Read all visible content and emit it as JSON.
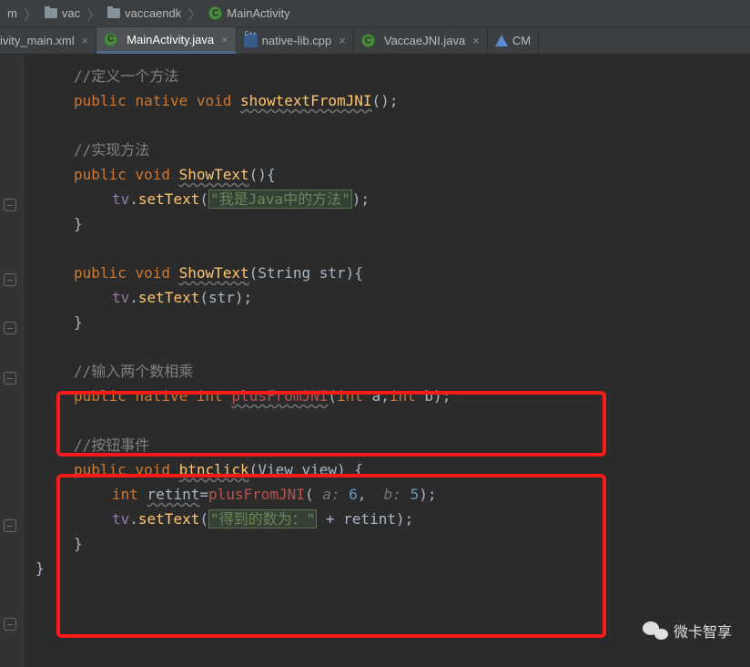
{
  "breadcrumb": {
    "item1": "m",
    "item2": "vac",
    "item3": "vaccaendk",
    "item4": "MainActivity"
  },
  "tabs": {
    "t1": "ivity_main.xml",
    "t2": "MainActivity.java",
    "t3": "native-lib.cpp",
    "t4": "VaccaeJNI.java",
    "t5": "CM"
  },
  "code": {
    "c1": "//定义一个方法",
    "kw_public": "public",
    "kw_native": "native",
    "kw_void": "void",
    "kw_int": "int",
    "m_showtext": "showtextFromJNI",
    "c2": "//实现方法",
    "m_ShowText": "ShowText",
    "f_tv": "tv",
    "m_setText": "setText",
    "s1": "\"我是Java中的方法\"",
    "p_String": "String",
    "p_str": "str",
    "c3": "//输入两个数相乘",
    "m_plus": "plusFromJNI",
    "p_a": "a",
    "p_b": "b",
    "c4": "//按钮事件",
    "m_btnclick": "btnclick",
    "p_View": "View",
    "p_view": "view",
    "v_retint": "retint",
    "hint_a": "a: ",
    "num_6": "6",
    "hint_b": "b: ",
    "num_5": "5",
    "s2": "\"得到的数为：\"",
    "plus_retint": " + retint"
  },
  "watermark": "微卡智享"
}
